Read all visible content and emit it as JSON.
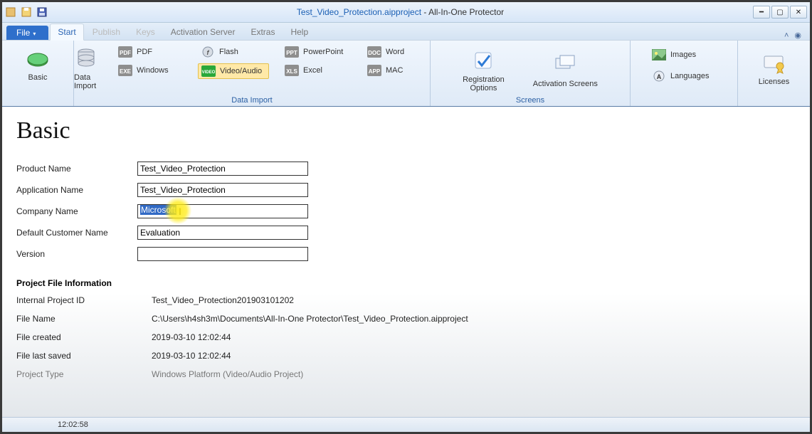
{
  "title": {
    "project": "Test_Video_Protection.aipproject",
    "suffix": " - All-In-One Protector"
  },
  "tabs": {
    "file": "File",
    "start": "Start",
    "publish": "Publish",
    "keys": "Keys",
    "activation_server": "Activation Server",
    "extras": "Extras",
    "help": "Help"
  },
  "ribbon": {
    "basic": "Basic",
    "data_import": "Data Import",
    "data_import_group": "Data Import",
    "pdf": "PDF",
    "windows": "Windows",
    "flash": "Flash",
    "video_audio": "Video/Audio",
    "powerpoint": "PowerPoint",
    "excel": "Excel",
    "word": "Word",
    "mac": "MAC",
    "registration_options": "Registration\nOptions",
    "activation_screens": "Activation Screens",
    "screens_group": "Screens",
    "images": "Images",
    "languages": "Languages",
    "licenses": "Licenses"
  },
  "page": {
    "heading": "Basic",
    "labels": {
      "product_name": "Product Name",
      "application_name": "Application Name",
      "company_name": "Company Name",
      "default_customer_name": "Default Customer Name",
      "version": "Version"
    },
    "values": {
      "product_name": "Test_Video_Protection",
      "application_name": "Test_Video_Protection",
      "company_name": "Microsoft",
      "default_customer_name": "Evaluation",
      "version": ""
    },
    "info_heading": "Project File Information",
    "info_labels": {
      "internal_project_id": "Internal Project ID",
      "file_name": "File Name",
      "file_created": "File created",
      "file_last_saved": "File last saved",
      "project_type": "Project Type"
    },
    "info_values": {
      "internal_project_id": "Test_Video_Protection201903101202",
      "file_name": "C:\\Users\\h4sh3m\\Documents\\All-In-One Protector\\Test_Video_Protection.aipproject",
      "file_created": "2019-03-10 12:02:44",
      "file_last_saved": "2019-03-10 12:02:44",
      "project_type": "Windows Platform (Video/Audio Project)"
    }
  },
  "statusbar": {
    "time": "12:02:58"
  }
}
